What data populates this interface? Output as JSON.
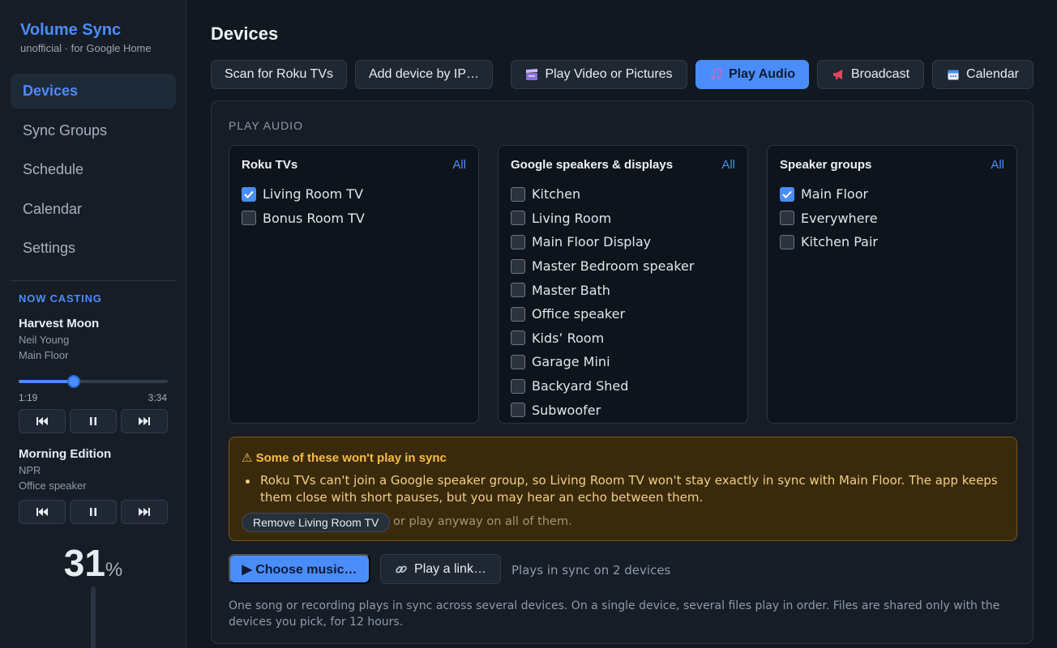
{
  "app": {
    "title": "Volume Sync",
    "subtitle": "unofficial · for Google Home"
  },
  "nav": [
    {
      "label": "Devices",
      "active": true
    },
    {
      "label": "Sync Groups"
    },
    {
      "label": "Schedule"
    },
    {
      "label": "Calendar"
    },
    {
      "label": "Settings"
    }
  ],
  "now_casting": {
    "label": "NOW CASTING",
    "items": [
      {
        "title": "Harvest Moon",
        "artist": "Neil Young",
        "target": "Main Floor",
        "elapsed": "1:19",
        "duration": "3:34",
        "progress_pct": 37
      },
      {
        "title": "Morning Edition",
        "artist": "NPR",
        "target": "Office speaker"
      }
    ]
  },
  "volume": {
    "value": "31",
    "unit": "%",
    "level_pct": 31
  },
  "page": {
    "title": "Devices"
  },
  "toolbar": {
    "scan": "Scan for Roku TVs",
    "add_ip": "Add device by IP…",
    "tabs": [
      {
        "label": "Play Video or Pictures",
        "icon": "clapperboard-icon",
        "active": false
      },
      {
        "label": "Play Audio",
        "icon": "music-note-icon",
        "active": true
      },
      {
        "label": "Broadcast",
        "icon": "megaphone-icon",
        "active": false
      },
      {
        "label": "Calendar",
        "icon": "calendar-icon",
        "active": false
      }
    ]
  },
  "panel": {
    "label": "PLAY AUDIO",
    "columns": [
      {
        "title": "Roku TVs",
        "all": "All",
        "items": [
          {
            "label": "Living Room TV",
            "checked": true
          },
          {
            "label": "Bonus Room TV",
            "checked": false
          }
        ]
      },
      {
        "title": "Google speakers & displays",
        "all": "All",
        "items": [
          {
            "label": "Kitchen",
            "checked": false
          },
          {
            "label": "Living Room",
            "checked": false
          },
          {
            "label": "Main Floor Display",
            "checked": false
          },
          {
            "label": "Master Bedroom speaker",
            "checked": false
          },
          {
            "label": "Master Bath",
            "checked": false
          },
          {
            "label": "Office speaker",
            "checked": false
          },
          {
            "label": "Kids’ Room",
            "checked": false
          },
          {
            "label": "Garage Mini",
            "checked": false
          },
          {
            "label": "Backyard Shed",
            "checked": false
          },
          {
            "label": "Subwoofer",
            "checked": false
          }
        ]
      },
      {
        "title": "Speaker groups",
        "all": "All",
        "items": [
          {
            "label": "Main Floor",
            "checked": true
          },
          {
            "label": "Everywhere",
            "checked": false
          },
          {
            "label": "Kitchen Pair",
            "checked": false
          }
        ]
      }
    ],
    "warning": {
      "title": "⚠ Some of these won't play in sync",
      "text": "Roku TVs can't join a Google speaker group, so Living Room TV won't stay exactly in sync with Main Floor. The app keeps them close with short pauses, but you may hear an echo between them.",
      "button": "Remove Living Room TV",
      "or_text": "or play anyway on all of them."
    },
    "actions": {
      "choose": "▶ Choose music…",
      "link": "Play a link…",
      "note": "Plays in sync on 2 devices"
    },
    "footnote": "One song or recording plays in sync across several devices. On a single device, several files play in order. Files are shared only with the devices you pick, for 12 hours."
  },
  "colors": {
    "accent": "#4b8df8",
    "warning_bg": "#3a2a0c",
    "warning_text": "#f6bd48"
  }
}
